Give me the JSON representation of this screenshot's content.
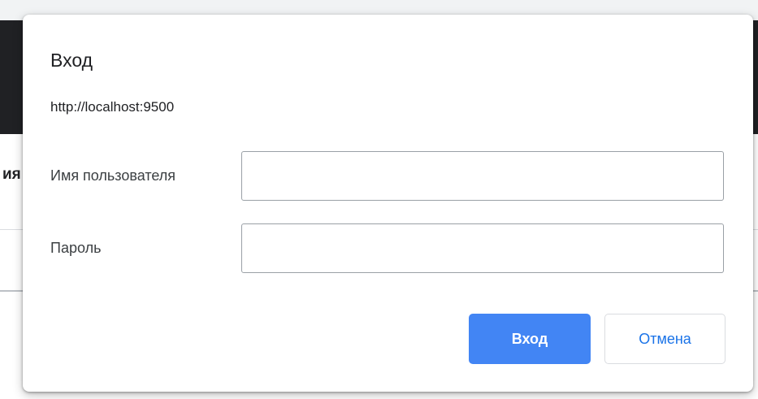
{
  "background": {
    "clipped_heading": "ия"
  },
  "dialog": {
    "title": "Вход",
    "origin": "http://localhost:9500",
    "username": {
      "label": "Имя пользователя",
      "value": ""
    },
    "password": {
      "label": "Пароль",
      "value": ""
    },
    "submit_label": "Вход",
    "cancel_label": "Отмена"
  },
  "colors": {
    "primary": "#4285f4",
    "link": "#1a73e8",
    "header_dark": "#202124"
  }
}
